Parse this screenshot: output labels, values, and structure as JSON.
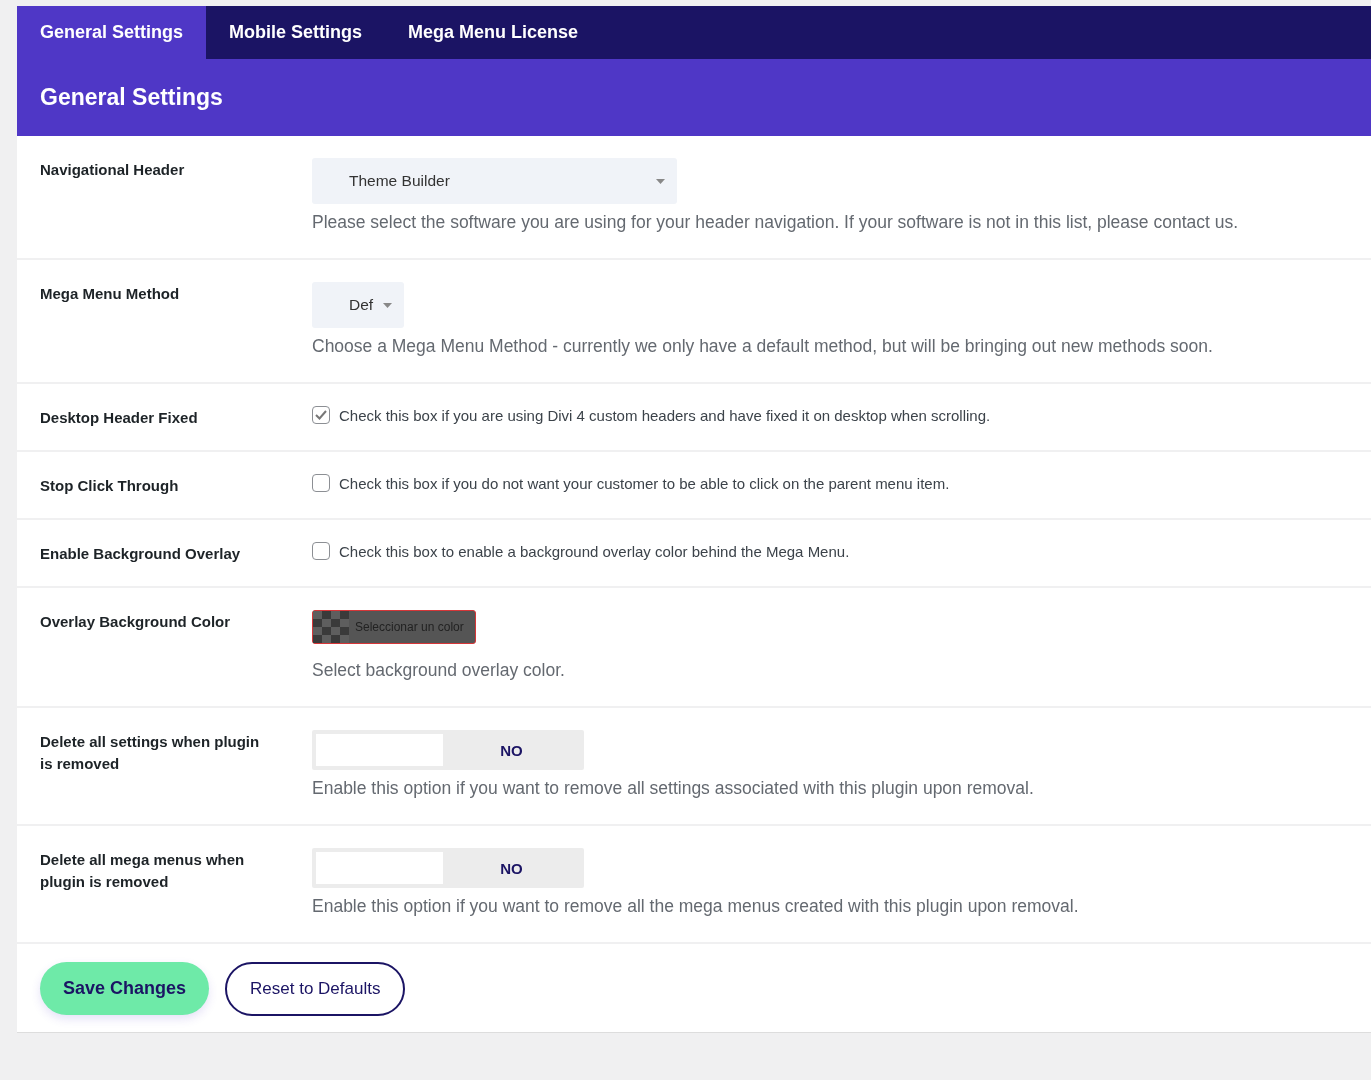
{
  "tabs": [
    {
      "label": "General Settings",
      "selected": true
    },
    {
      "label": "Mobile Settings",
      "selected": false
    },
    {
      "label": "Mega Menu License",
      "selected": false
    }
  ],
  "section_title": "General Settings",
  "settings": [
    {
      "kind": "select",
      "label": "Navigational Header",
      "value": "Theme Builder",
      "wide": true,
      "description": "Please select the software you are using for your header navigation. If your software is not in this list, please contact us."
    },
    {
      "kind": "select",
      "label": "Mega Menu Method",
      "value": "Def",
      "wide": false,
      "description": "Choose a Mega Menu Method - currently we only have a default method, but will be bringing out new methods soon."
    },
    {
      "kind": "checkbox",
      "label": "Desktop Header Fixed",
      "checked": true,
      "description": "Check this box if you are using Divi 4 custom headers and have fixed it on desktop when scrolling."
    },
    {
      "kind": "checkbox",
      "label": "Stop Click Through",
      "checked": false,
      "description": "Check this box if you do not want your customer to be able to click on the parent menu item."
    },
    {
      "kind": "checkbox",
      "label": "Enable Background Overlay",
      "checked": false,
      "description": "Check this box to enable a background overlay color behind the Mega Menu."
    },
    {
      "kind": "color",
      "label": "Overlay Background Color",
      "button": "Seleccionar un color",
      "description": "Select background overlay color."
    },
    {
      "kind": "toggle",
      "label": "Delete all settings when plugin is removed",
      "on": false,
      "state_text": "NO",
      "description": "Enable this option if you want to remove all settings associated with this plugin upon removal."
    },
    {
      "kind": "toggle",
      "label": "Delete all mega menus when plugin is removed",
      "on": false,
      "state_text": "NO",
      "description": "Enable this option if you want to remove all the mega menus created with this plugin upon removal."
    }
  ],
  "buttons": {
    "save": "Save Changes",
    "reset": "Reset to Defaults"
  }
}
